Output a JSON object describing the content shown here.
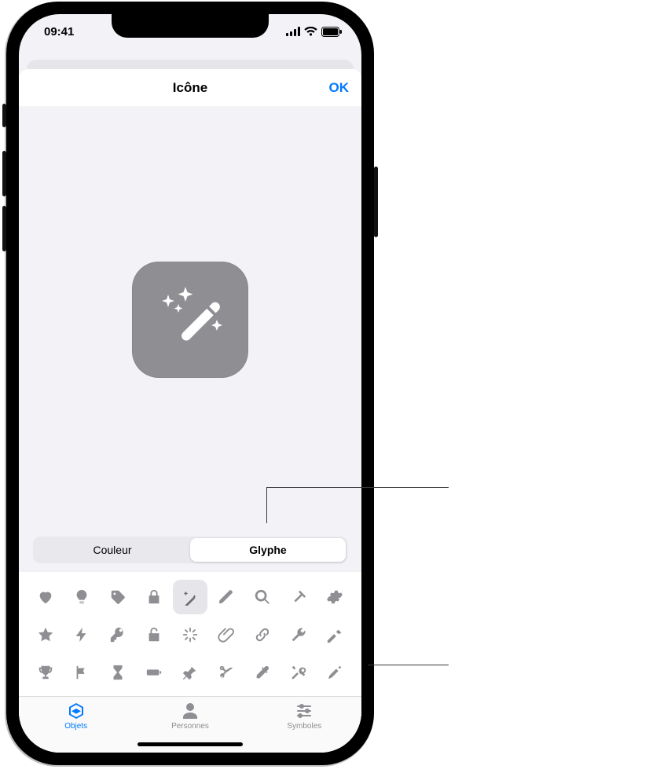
{
  "status": {
    "time": "09:41"
  },
  "nav": {
    "title": "Icône",
    "done": "OK"
  },
  "preview": {
    "glyph_name": "magic-wand"
  },
  "segmented": {
    "items": [
      "Couleur",
      "Glyphe"
    ],
    "selected_index": 1
  },
  "glyphs": {
    "rows": [
      [
        "heart",
        "lightbulb",
        "tag",
        "lock",
        "magic-wand",
        "pencil",
        "magnifier",
        "hammer-angled",
        "gear"
      ],
      [
        "star",
        "bolt",
        "key",
        "unlock",
        "sparkle",
        "paperclip",
        "chain-link",
        "wrench",
        "hammer"
      ],
      [
        "trophy",
        "flag",
        "hourglass",
        "battery",
        "pin",
        "scissors",
        "eyedropper",
        "tools",
        "screwdriver"
      ]
    ],
    "selected": "magic-wand"
  },
  "tabs": {
    "items": [
      {
        "id": "objects",
        "label": "Objets"
      },
      {
        "id": "people",
        "label": "Personnes"
      },
      {
        "id": "symbols",
        "label": "Symboles"
      }
    ],
    "selected_index": 0
  }
}
